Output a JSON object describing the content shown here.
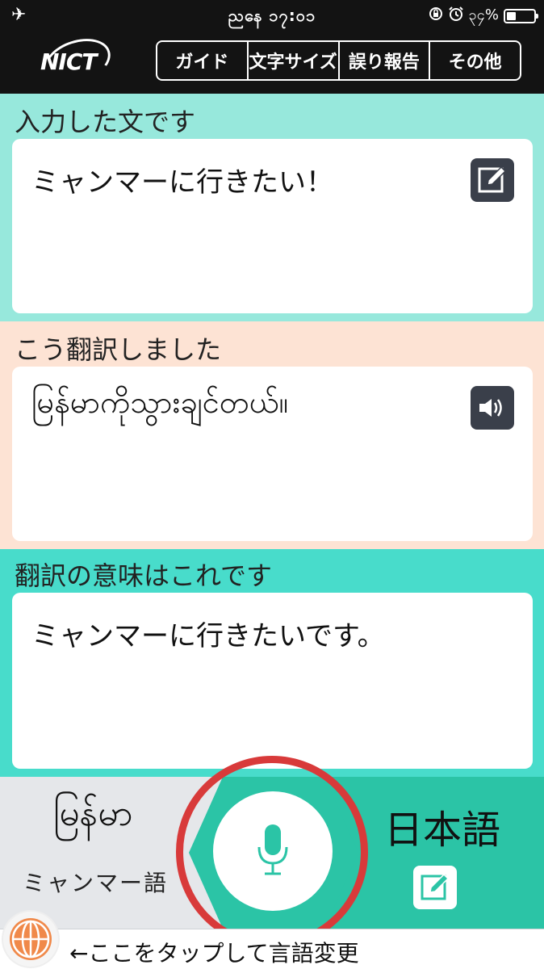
{
  "status": {
    "time": "ညနေ ၁၇:၀၁",
    "battery_text": "၃၄%",
    "battery_level": 0.34
  },
  "header": {
    "logo_text": "NICT",
    "menu": [
      {
        "label": "ガイド"
      },
      {
        "label": "文字サイズ"
      },
      {
        "label": "誤り報告"
      },
      {
        "label": "その他"
      }
    ]
  },
  "input_section": {
    "title": "入力した文です",
    "text": "ミャンマーに行きたい！",
    "icon": "edit-icon"
  },
  "translation_section": {
    "title": "こう翻訳しました",
    "text": "မြန်မာကိုသွားချင်တယ်။",
    "icon": "speaker-icon"
  },
  "meaning_section": {
    "title": "翻訳の意味はこれです",
    "text": "ミャンマーに行きたいです。"
  },
  "languages": {
    "source_native": "မြန်မာ",
    "source_label": "ミャンマー語",
    "target_label": "日本語"
  },
  "footer": {
    "hint": "←ここをタップして言語変更"
  },
  "colors": {
    "section1_bg": "#97e8dc",
    "section2_bg": "#fde3d4",
    "section3_bg": "#48dccb",
    "accent_green": "#2bc4a6",
    "highlight_red": "#d83a3a",
    "globe_orange": "#f0894a"
  }
}
